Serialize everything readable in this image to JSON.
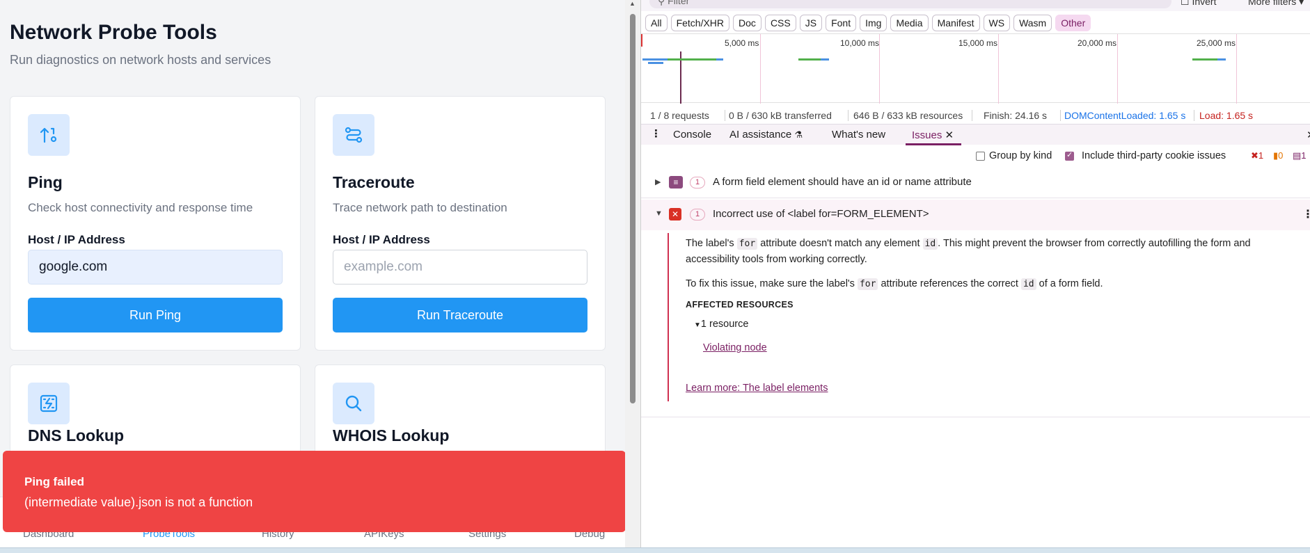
{
  "app": {
    "title": "Network Probe Tools",
    "subtitle": "Run diagnostics on network hosts and services",
    "tools": [
      {
        "title": "Ping",
        "description": "Check host connectivity and response time",
        "field_label": "Host / IP Address",
        "value": "google.com",
        "placeholder": "",
        "button": "Run Ping"
      },
      {
        "title": "Traceroute",
        "description": "Trace network path to destination",
        "field_label": "Host / IP Address",
        "value": "",
        "placeholder": "example.com",
        "button": "Run Traceroute"
      },
      {
        "title": "DNS Lookup"
      },
      {
        "title": "WHOIS Lookup"
      }
    ],
    "nav": [
      "Dashboard",
      "ProbeTools",
      "History",
      "APIKeys",
      "Settings",
      "Debug"
    ],
    "nav_active": "ProbeTools",
    "toast": {
      "title": "Ping failed",
      "message": "(intermediate value).json is not a function"
    },
    "accent_color": "#2196f3",
    "error_color": "#ef4444"
  },
  "devtools": {
    "filter_placeholder": "Filter",
    "invert_label": "Invert",
    "more_filters_label": "More filters",
    "type_filters": [
      "All",
      "Fetch/XHR",
      "Doc",
      "CSS",
      "JS",
      "Font",
      "Img",
      "Media",
      "Manifest",
      "WS",
      "Wasm",
      "Other"
    ],
    "type_filter_active": "Other",
    "timeline_ticks": [
      "5,000 ms",
      "10,000 ms",
      "15,000 ms",
      "20,000 ms",
      "25,000 ms"
    ],
    "summary": {
      "requests": "1 / 8 requests",
      "transferred": "0 B / 630 kB transferred",
      "resources": "646 B / 633 kB resources",
      "finish": "Finish: 24.16 s",
      "dom_content_loaded": "DOMContentLoaded: 1.65 s",
      "load": "Load: 1.65 s"
    },
    "drawer_tabs": [
      "Console",
      "AI assistance",
      "What's new",
      "Issues"
    ],
    "drawer_tab_active": "Issues",
    "issues_toolbar": {
      "group_by_kind": "Group by kind",
      "group_by_kind_checked": false,
      "include_third_party": "Include third-party cookie issues",
      "include_third_party_checked": true,
      "counts": {
        "errors": "1",
        "warnings": "0",
        "info": "1"
      }
    },
    "issues": [
      {
        "count": "1",
        "title": "A form field element should have an id or name attribute",
        "kind": "info",
        "expanded": false
      },
      {
        "count": "1",
        "title": "Incorrect use of <label for=FORM_ELEMENT>",
        "kind": "error",
        "expanded": true
      }
    ],
    "issue_detail": {
      "p1_a": "The label's ",
      "p1_code1": "for",
      "p1_b": " attribute doesn't match any element ",
      "p1_code2": "id",
      "p1_c": ". This might prevent the browser from correctly autofilling the form and",
      "p1_d": "accessibility tools from working correctly.",
      "p2_a": "To fix this issue, make sure the label's ",
      "p2_code1": "for",
      "p2_b": " attribute references the correct ",
      "p2_code2": "id",
      "p2_c": " of a form field.",
      "affected_heading": "AFFECTED RESOURCES",
      "resource_count": "1 resource",
      "violating_node": "Violating node",
      "learn_more": "Learn more: The label elements"
    },
    "colors": {
      "accent": "#7a1f63",
      "dcl": "#1a73e8",
      "load": "#c5221f"
    }
  }
}
